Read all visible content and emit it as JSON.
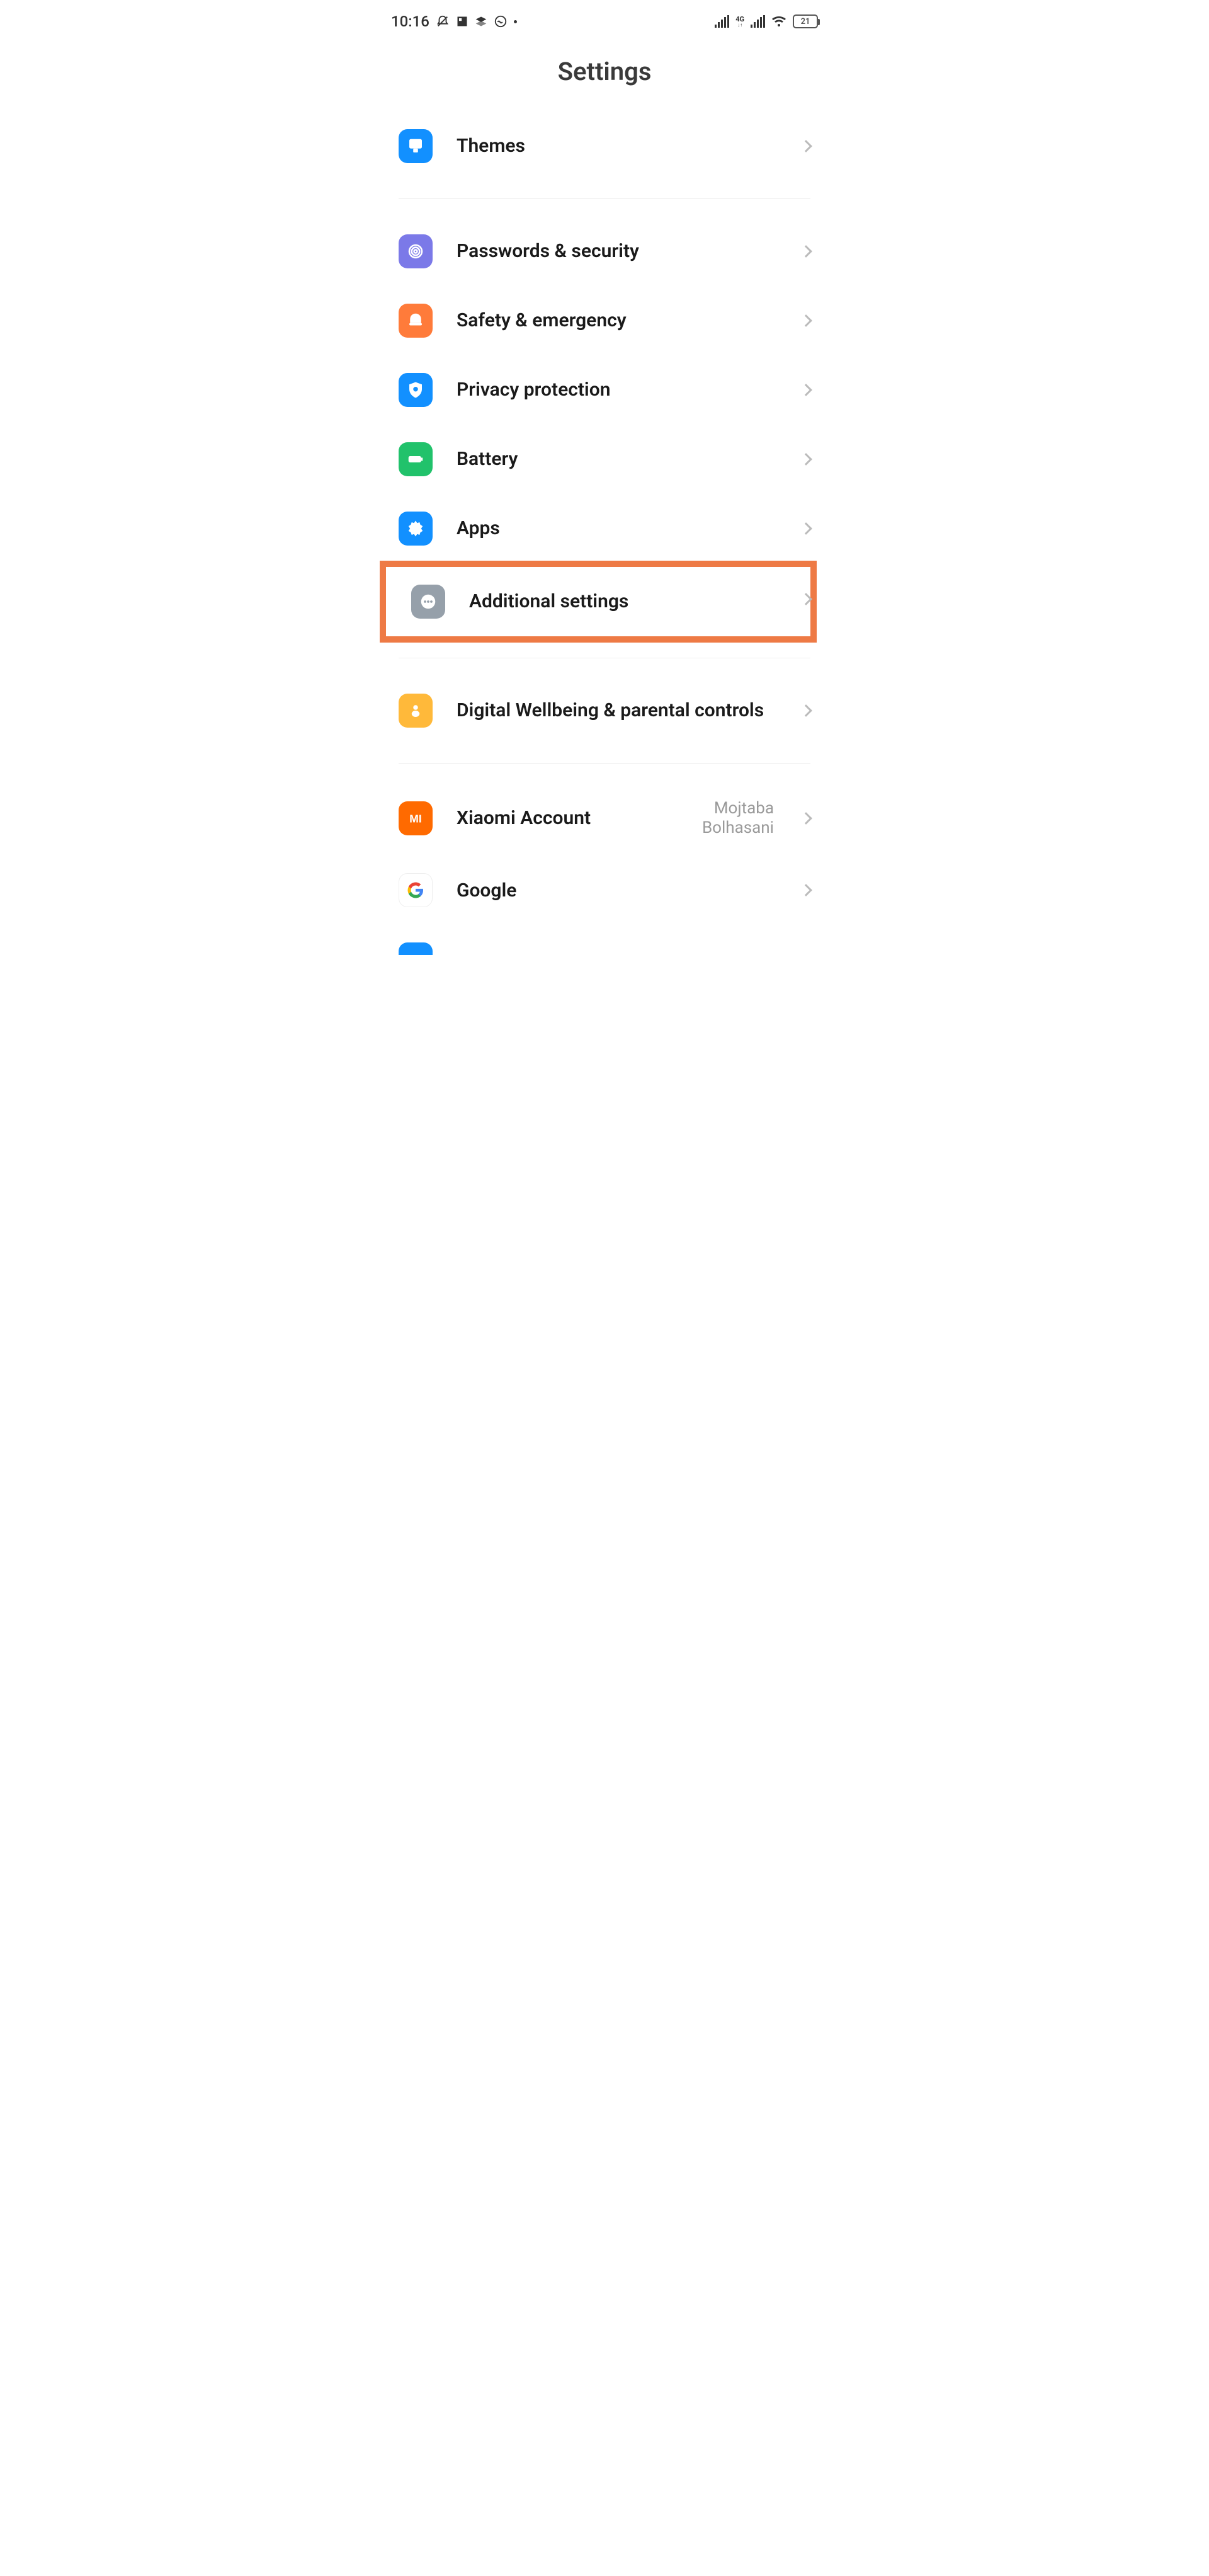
{
  "status": {
    "time": "10:16",
    "battery": "21",
    "net": "4G"
  },
  "page": {
    "title": "Settings"
  },
  "items": {
    "themes": "Themes",
    "passwords": "Passwords & security",
    "safety": "Safety & emergency",
    "privacy": "Privacy protection",
    "battery": "Battery",
    "apps": "Apps",
    "additional": "Additional settings",
    "wellbeing": "Digital Wellbeing & parental controls",
    "xiaomi": "Xiaomi Account",
    "xiaomi_value": "Mojtaba Bolhasani",
    "google": "Google"
  }
}
